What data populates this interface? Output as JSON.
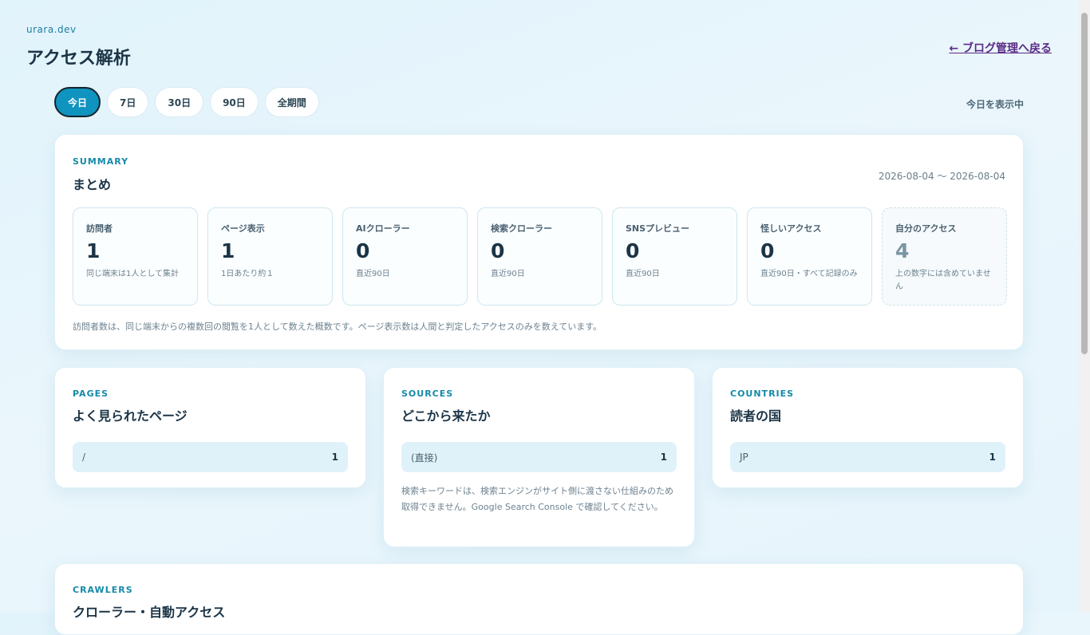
{
  "header": {
    "site_name": "urara.dev",
    "title": "アクセス解析",
    "back_link": "← ブログ管理へ戻る"
  },
  "range": {
    "options": [
      "今日",
      "7日",
      "30日",
      "90日",
      "全期間"
    ],
    "selected": "今日",
    "status": "今日を表示中"
  },
  "summary": {
    "kicker": "SUMMARY",
    "title": "まとめ",
    "date_range": "2026-08-04 〜 2026-08-04",
    "stats": [
      {
        "label": "訪問者",
        "value": "1",
        "note": "同じ端末は1人として集計"
      },
      {
        "label": "ページ表示",
        "value": "1",
        "note": "1日あたり約１"
      },
      {
        "label": "AIクローラー",
        "value": "0",
        "note": "直近90日"
      },
      {
        "label": "検索クローラー",
        "value": "0",
        "note": "直近90日"
      },
      {
        "label": "SNSプレビュー",
        "value": "0",
        "note": "直近90日"
      },
      {
        "label": "怪しいアクセス",
        "value": "0",
        "note": "直近90日・すべて記録のみ"
      },
      {
        "label": "自分のアクセス",
        "value": "4",
        "note": "上の数字には含めていません"
      }
    ],
    "footnote": "訪問者数は、同じ端末からの複数回の閲覧を1人として数えた概数です。ページ表示数は人間と判定したアクセスのみを数えています。"
  },
  "pages": {
    "kicker": "PAGES",
    "title": "よく見られたページ",
    "rows": [
      {
        "label": "/",
        "count": "1"
      }
    ]
  },
  "sources": {
    "kicker": "SOURCES",
    "title": "どこから来たか",
    "rows": [
      {
        "label": "(直接)",
        "count": "1"
      }
    ],
    "note": "検索キーワードは、検索エンジンがサイト側に渡さない仕組みのため取得できません。Google Search Console で確認してください。"
  },
  "countries": {
    "kicker": "COUNTRIES",
    "title": "読者の国",
    "rows": [
      {
        "label": "JP",
        "count": "1"
      }
    ]
  },
  "crawlers": {
    "kicker": "CRAWLERS",
    "title": "クローラー・自動アクセス"
  }
}
